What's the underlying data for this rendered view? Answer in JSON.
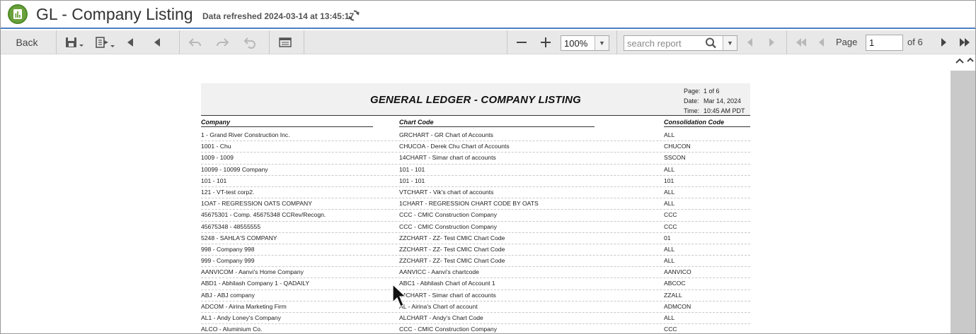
{
  "app": {
    "title": "GL - Company Listing",
    "refreshed": "Data refreshed 2024-03-14 at 13:45:17"
  },
  "toolbar": {
    "back_label": "Back",
    "zoom_value": "100%",
    "search_placeholder": "search report",
    "page_label": "Page",
    "page_value": "1",
    "of_label": "of  6"
  },
  "report": {
    "title": "GENERAL LEDGER - COMPANY LISTING",
    "meta": [
      {
        "key": "Page:",
        "value": "1      of      6"
      },
      {
        "key": "Date:",
        "value": "Mar 14, 2024"
      },
      {
        "key": "Time:",
        "value": "10:45 AM PDT"
      }
    ],
    "columns": [
      "Company",
      "Chart Code",
      "Consolidation Code"
    ],
    "rows": [
      [
        "1 - Grand River Construction Inc.",
        "GRCHART - GR Chart of Accounts",
        "ALL"
      ],
      [
        "1001 - Chu",
        "CHUCOA - Derek Chu Chart of Accounts",
        "CHUCON"
      ],
      [
        "1009 - 1009",
        "14CHART - Simar chart of accounts",
        "SSCON"
      ],
      [
        "10099 - 10099 Company",
        "101 - 101",
        "ALL"
      ],
      [
        "101 - 101",
        "101 - 101",
        "101"
      ],
      [
        "121 - VT-test corp2.",
        "VTCHART - Vik's chart of accounts",
        "ALL"
      ],
      [
        "1OAT - REGRESSION OATS COMPANY",
        "1CHART - REGRESSION CHART CODE BY OATS",
        "ALL"
      ],
      [
        "45675301 - Comp. 45675348 CCRev/Recogn.",
        "CCC - CMIC Construction Company",
        "CCC"
      ],
      [
        "45675348 - 48555555",
        "CCC - CMIC Construction Company",
        "CCC"
      ],
      [
        "5248 - SAHLA'S COMPANY",
        "ZZCHART - ZZ- Test CMIC Chart Code",
        "01"
      ],
      [
        "998 - Company 998",
        "ZZCHART - ZZ- Test CMIC Chart Code",
        "ALL"
      ],
      [
        "999 - Company 999",
        "ZZCHART - ZZ- Test CMIC Chart Code",
        "ALL"
      ],
      [
        "AANVICOM - Aanvi's Home Company",
        "AANVICC - Aanvi's chartcode",
        "AANVICO"
      ],
      [
        "ABD1 - Abhilash Company 1 - QADAILY",
        "ABC1 - Abhilash Chart of Account 1",
        "ABCOC"
      ],
      [
        "ABJ - ABJ company",
        "14CHART - Simar chart of accounts",
        "ZZALL"
      ],
      [
        "ADCOM - Airina Marketing Firm",
        "AL - Airina's Chart of account",
        "ADMCON"
      ],
      [
        "AL1 - Andy Loney's Company",
        "ALCHART - Andy's Chart Code",
        "ALL"
      ],
      [
        "ALCO - Aluminium Co.",
        "CCC - CMIC Construction Company",
        "CCC"
      ]
    ]
  },
  "colors": {
    "accent": "#4a7fc1",
    "app_icon": "#6aa13c",
    "toolbar_bg": "#e8e8e8"
  },
  "icons": [
    "app-logo-icon",
    "refresh-icon",
    "save-icon",
    "export-icon",
    "first-section-icon",
    "prev-section-icon",
    "undo-icon",
    "redo-icon",
    "reset-icon",
    "toggle-panel-icon",
    "zoom-out-icon",
    "zoom-in-icon",
    "search-icon",
    "find-prev-icon",
    "find-next-icon",
    "first-page-icon",
    "prev-page-icon",
    "next-page-icon",
    "last-page-icon",
    "mouse-cursor-icon"
  ]
}
